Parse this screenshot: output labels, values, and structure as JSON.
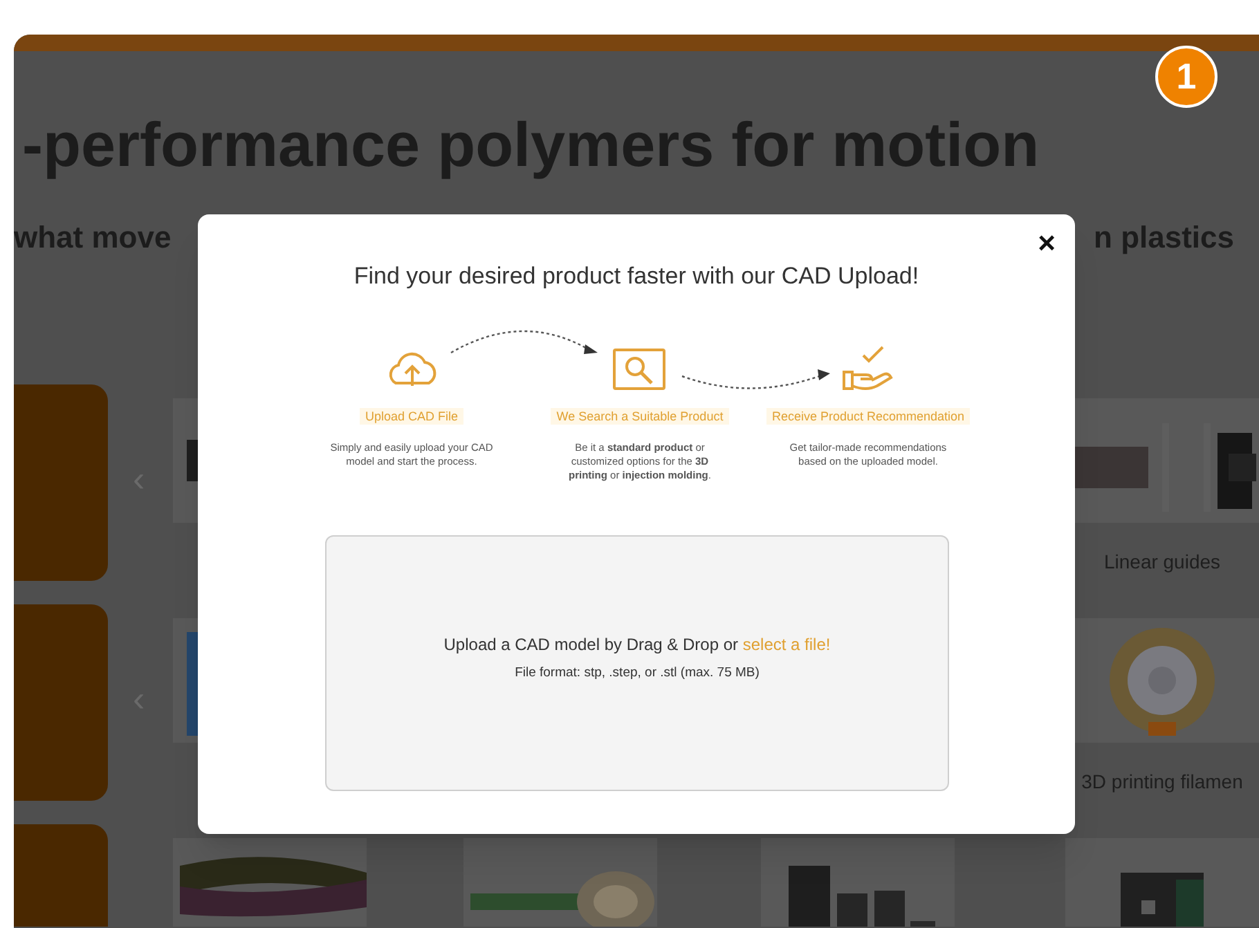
{
  "badge": {
    "text": "1"
  },
  "page": {
    "heading": "-performance polymers for motion",
    "subheading_left": "what move",
    "subheading_right": "n plastics",
    "rows": [
      {
        "arrow": "‹",
        "items": [
          {
            "kind": "picture"
          },
          {
            "kind": "picture",
            "label": "Linear guides"
          }
        ]
      },
      {
        "arrow": "‹",
        "items": [
          {
            "kind": "picture"
          },
          {
            "kind": "picture",
            "label": "3D printing filamen"
          }
        ]
      },
      {
        "items": [
          {
            "kind": "picture"
          },
          {
            "kind": "picture"
          },
          {
            "kind": "picture"
          },
          {
            "kind": "picture"
          }
        ]
      }
    ]
  },
  "modal": {
    "title": "Find your desired product faster with our CAD Upload!",
    "close": "×",
    "steps": [
      {
        "kind": "upload",
        "label": "Upload CAD File",
        "description": "Simply and easily upload your CAD model and start the process."
      },
      {
        "kind": "search",
        "label": "We Search a Suitable Product",
        "description": "Be it a **standard product** or customized options for the **3D printing** or **injection molding**."
      },
      {
        "kind": "recommend",
        "label": "Receive Product Recommendation",
        "description": "Get tailor-made recommendations based on the uploaded model."
      }
    ],
    "dropzone": {
      "text": "Upload a CAD model by Drag & Drop or",
      "link": "select a file!",
      "note": "File format: stp, .step, or .stl (max. 75 MB)"
    }
  }
}
